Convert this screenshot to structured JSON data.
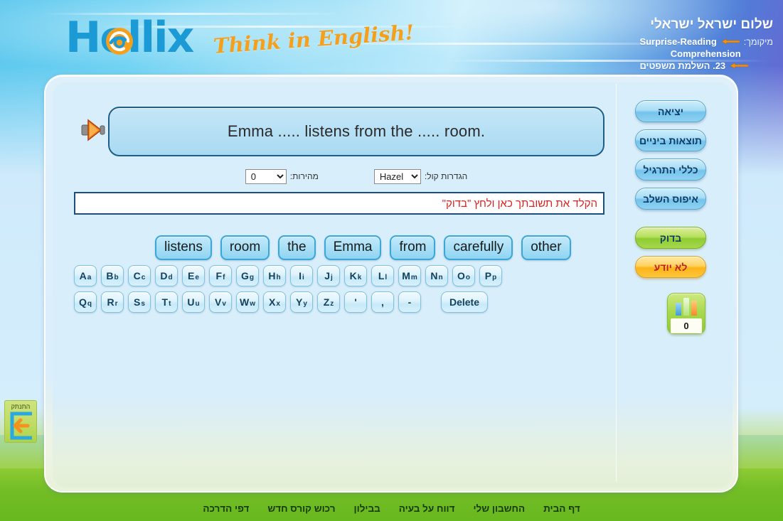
{
  "header": {
    "logo_text": "Hellix",
    "tagline": "Think in English!",
    "greeting": "שלום ישראל ישראלי",
    "location_label": "מיקומך:",
    "location_line1": "Surprise-Reading",
    "location_line2": "Comprehension",
    "location_line3": "23. השלמת משפטים",
    "arrow_icon": "left-arrow-marker-icon"
  },
  "exercise": {
    "speaker_icon": "speaker-icon",
    "sentence": "Emma ..... listens from the ..... room.",
    "voice_settings_label": "הגדרות קול:",
    "voice_selected": "Hazel",
    "voice_options": [
      "Hazel"
    ],
    "speed_label": "מהירות:",
    "speed_selected": "0",
    "speed_options": [
      "0"
    ],
    "answer_value": "",
    "answer_placeholder": "הקלד את תשובתך כאן ולחץ \"בדוק\"",
    "word_bank": [
      "listens",
      "room",
      "the",
      "Emma",
      "from",
      "carefully",
      "other"
    ]
  },
  "keyboard": {
    "row1": [
      {
        "upper": "A",
        "lower": "a"
      },
      {
        "upper": "B",
        "lower": "b"
      },
      {
        "upper": "C",
        "lower": "c"
      },
      {
        "upper": "D",
        "lower": "d"
      },
      {
        "upper": "E",
        "lower": "e"
      },
      {
        "upper": "F",
        "lower": "f"
      },
      {
        "upper": "G",
        "lower": "g"
      },
      {
        "upper": "H",
        "lower": "h"
      },
      {
        "upper": "I",
        "lower": "i"
      },
      {
        "upper": "J",
        "lower": "j"
      },
      {
        "upper": "K",
        "lower": "k"
      },
      {
        "upper": "L",
        "lower": "l"
      },
      {
        "upper": "M",
        "lower": "m"
      },
      {
        "upper": "N",
        "lower": "n"
      },
      {
        "upper": "O",
        "lower": "o"
      },
      {
        "upper": "P",
        "lower": "p"
      }
    ],
    "row2": [
      {
        "upper": "Q",
        "lower": "q"
      },
      {
        "upper": "R",
        "lower": "r"
      },
      {
        "upper": "S",
        "lower": "s"
      },
      {
        "upper": "T",
        "lower": "t"
      },
      {
        "upper": "U",
        "lower": "u"
      },
      {
        "upper": "V",
        "lower": "v"
      },
      {
        "upper": "W",
        "lower": "w"
      },
      {
        "upper": "X",
        "lower": "x"
      },
      {
        "upper": "Y",
        "lower": "y"
      },
      {
        "upper": "Z",
        "lower": "z"
      },
      {
        "upper": "'",
        "lower": ""
      },
      {
        "upper": ",",
        "lower": ""
      },
      {
        "upper": "-",
        "lower": ""
      }
    ],
    "delete_label": "Delete"
  },
  "sidebar": {
    "buttons": [
      {
        "label": "יציאה",
        "style": "blue"
      },
      {
        "label": "תוצאות ביניים",
        "style": "blue"
      },
      {
        "label": "כללי התרגיל",
        "style": "blue"
      },
      {
        "label": "איפוס השלב",
        "style": "blue"
      },
      {
        "label": "בדוק",
        "style": "green"
      },
      {
        "label": "לא יודע",
        "style": "orange"
      }
    ],
    "score_widget": {
      "icon": "bar-chart-icon",
      "value": "0"
    }
  },
  "logout": {
    "label": "התנתק",
    "icon": "logout-arrow-icon"
  },
  "footer": {
    "links": [
      "דף הבית",
      "החשבון שלי",
      "דווח על בעיה",
      "בבילון",
      "רכוש קורס חדש",
      "דפי הדרכה"
    ]
  },
  "colors": {
    "brand_blue": "#1b9ad6",
    "tagline_orange": "#f5a01c",
    "placeholder_red": "#e02020",
    "check_green": "#8ecb33",
    "dontknow_orange": "#fbb417",
    "panel_bg": "#d9eefb"
  }
}
